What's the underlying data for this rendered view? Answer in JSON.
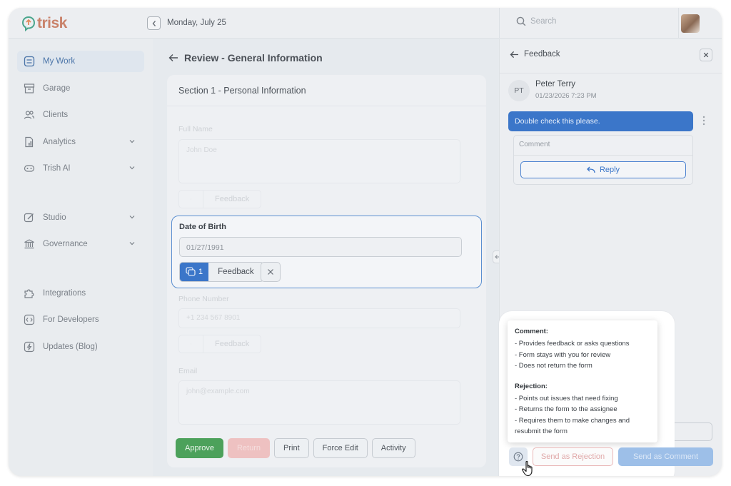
{
  "app": {
    "logo_text": "trisk"
  },
  "header": {
    "date": "Monday, July 25",
    "search_placeholder": "Search"
  },
  "sidebar": {
    "items": [
      {
        "label": "My Work"
      },
      {
        "label": "Garage"
      },
      {
        "label": "Clients"
      },
      {
        "label": "Analytics"
      },
      {
        "label": "Trish AI"
      },
      {
        "label": "Studio"
      },
      {
        "label": "Governance"
      },
      {
        "label": "Integrations"
      },
      {
        "label": "For Developers"
      },
      {
        "label": "Updates (Blog)"
      }
    ]
  },
  "main": {
    "title": "Review - General Information",
    "section_title": "Section 1 - Personal Information",
    "fields": {
      "full_name_label": "Full Name",
      "full_name_value": "John Doe",
      "dob_label": "Date of Birth",
      "dob_value": "01/27/1991",
      "dob_feedback_count": "1",
      "phone_label": "Phone Number",
      "phone_value": "+1 234 567 8901",
      "email_label": "Email",
      "email_value": "john@example.com",
      "feedback_label": "Feedback"
    },
    "buttons": {
      "approve": "Approve",
      "return": "Return",
      "print": "Print",
      "force_edit": "Force Edit",
      "activity": "Activity"
    }
  },
  "feedback_panel": {
    "title": "Feedback",
    "comment": {
      "initials": "PT",
      "author": "Peter Terry",
      "timestamp": "01/23/2026  7:23 PM",
      "text": "Double check this please."
    },
    "reply_placeholder": "Comment",
    "reply_label": "Reply",
    "send_rejection": "Send as Rejection",
    "send_comment": "Send as Comment"
  },
  "tooltip": {
    "comment_heading": "Comment:",
    "comment_lines": [
      "- Provides feedback or asks questions",
      "- Form stays with you for review",
      "- Does not return the form"
    ],
    "rejection_heading": "Rejection:",
    "rejection_lines": [
      "- Points out issues that need fixing",
      "- Returns the form to the assignee",
      "- Requires them to make changes and",
      "resubmit the form"
    ]
  }
}
